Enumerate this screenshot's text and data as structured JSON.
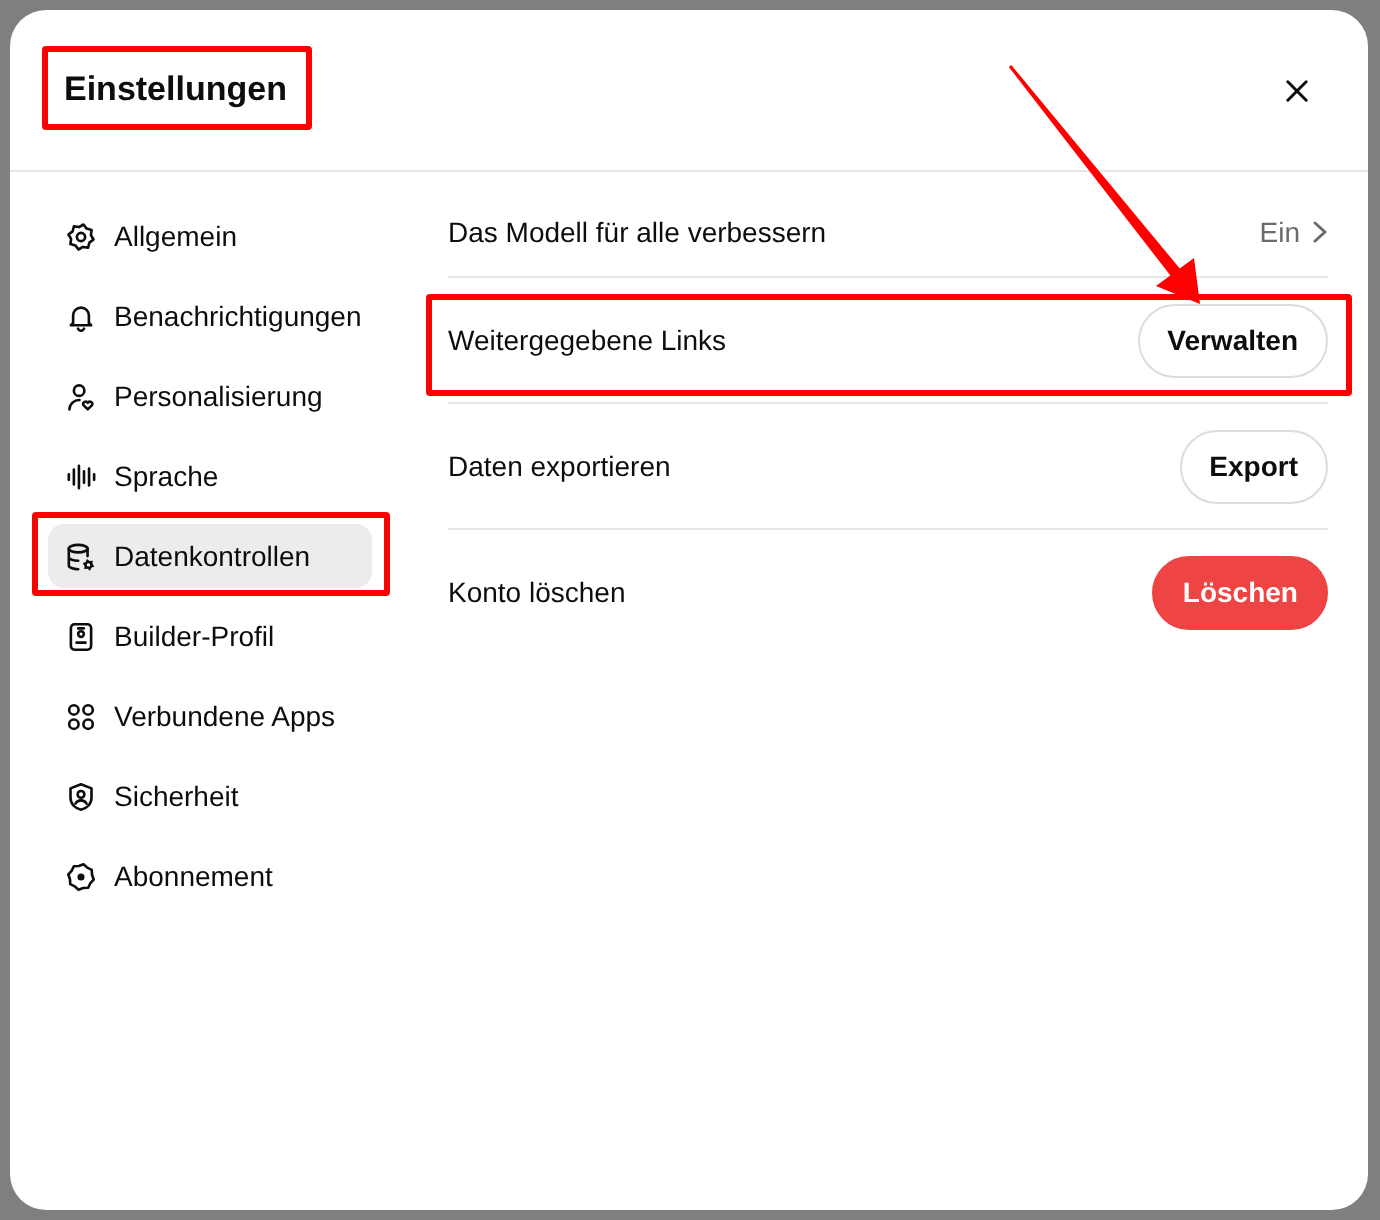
{
  "dialog": {
    "title": {
      "text": "Einstellungen",
      "highlighted": true
    },
    "arrow": true
  },
  "sidebar": {
    "items": [
      {
        "label": "Allgemein",
        "selected": false,
        "highlighted": false
      },
      {
        "label": "Benachrichtigungen",
        "selected": false,
        "highlighted": false
      },
      {
        "label": "Personalisierung",
        "selected": false,
        "highlighted": false
      },
      {
        "label": "Sprache",
        "selected": false,
        "highlighted": false
      },
      {
        "label": "Datenkontrollen",
        "selected": true,
        "highlighted": true
      },
      {
        "label": "Builder-Profil",
        "selected": false,
        "highlighted": false
      },
      {
        "label": "Verbundene Apps",
        "selected": false,
        "highlighted": false
      },
      {
        "label": "Sicherheit",
        "selected": false,
        "highlighted": false
      },
      {
        "label": "Abonnement",
        "selected": false,
        "highlighted": false
      }
    ]
  },
  "settings": {
    "rows": [
      {
        "kind": "link",
        "label": "Das Modell für alle verbessern",
        "value": "Ein",
        "highlighted": false
      },
      {
        "kind": "button",
        "label": "Weitergegebene Links",
        "button": "Verwalten",
        "highlighted": true
      },
      {
        "kind": "button",
        "label": "Daten exportieren",
        "button": "Export",
        "highlighted": false
      },
      {
        "kind": "danger",
        "label": "Konto löschen",
        "button": "Löschen",
        "highlighted": false
      }
    ]
  }
}
